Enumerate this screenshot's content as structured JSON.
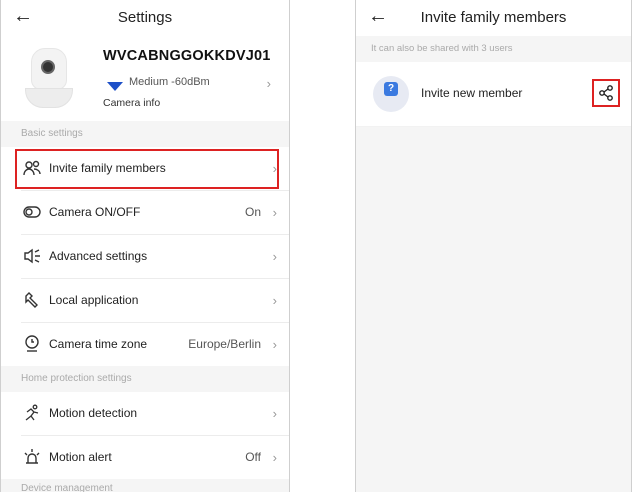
{
  "left": {
    "title": "Settings",
    "back_icon": "arrow-left-icon",
    "device": {
      "name": "WVCABNGGOKKDVJ01",
      "signal": "Medium -60dBm",
      "info": "Camera info"
    },
    "sections": {
      "basic": "Basic settings",
      "home": "Home protection settings",
      "cutoff": "Device management"
    },
    "items": [
      {
        "label": "Invite family members",
        "value": "",
        "icon": "people-icon"
      },
      {
        "label": "Camera ON/OFF",
        "value": "On",
        "icon": "toggle-icon"
      },
      {
        "label": "Advanced settings",
        "value": "",
        "icon": "speaker-settings-icon"
      },
      {
        "label": "Local application",
        "value": "",
        "icon": "wrench-icon"
      },
      {
        "label": "Camera time zone",
        "value": "Europe/Berlin",
        "icon": "location-clock-icon"
      },
      {
        "label": "Motion detection",
        "value": "",
        "icon": "running-icon"
      },
      {
        "label": "Motion alert",
        "value": "Off",
        "icon": "alarm-light-icon"
      }
    ]
  },
  "right": {
    "title": "Invite family members",
    "back_icon": "arrow-left-icon",
    "share_hint": "It can also be shared with 3 users",
    "invite_label": "Invite new member",
    "invite_badge": "?"
  },
  "colors": {
    "highlight": "#dd2222",
    "wifi": "#1e50c8",
    "question_badge": "#3b7ae0"
  }
}
